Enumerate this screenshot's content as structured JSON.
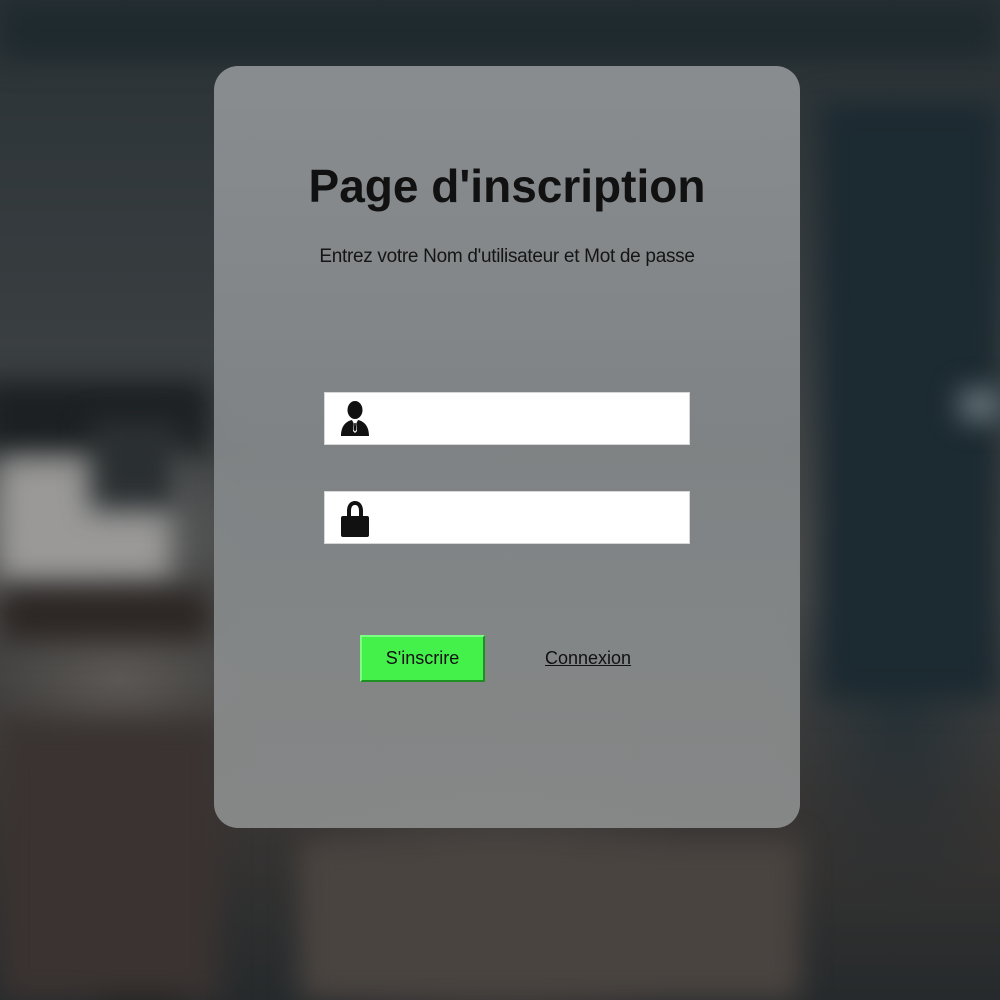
{
  "page": {
    "title": "Page d'inscription",
    "subtitle": "Entrez votre Nom d'utilisateur et Mot de passe"
  },
  "form": {
    "username": {
      "icon": "user-icon",
      "value": "",
      "placeholder": ""
    },
    "password": {
      "icon": "lock-icon",
      "value": "",
      "placeholder": ""
    },
    "signup_label": "S'inscrire",
    "login_label": "Connexion"
  },
  "colors": {
    "signup_button": "#44f04a",
    "card": "#8b8f91",
    "text": "#111111"
  }
}
